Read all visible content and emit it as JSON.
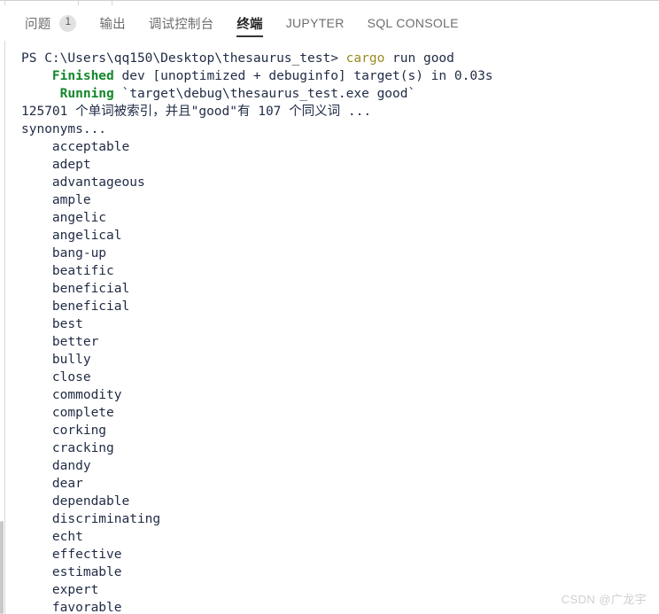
{
  "tabs": [
    {
      "label": "问题",
      "badge": "1",
      "active": false,
      "latin": false
    },
    {
      "label": "输出",
      "badge": null,
      "active": false,
      "latin": false
    },
    {
      "label": "调试控制台",
      "badge": null,
      "active": false,
      "latin": false
    },
    {
      "label": "终端",
      "badge": null,
      "active": true,
      "latin": false
    },
    {
      "label": "JUPYTER",
      "badge": null,
      "active": false,
      "latin": true
    },
    {
      "label": "SQL CONSOLE",
      "badge": null,
      "active": false,
      "latin": true
    }
  ],
  "terminal": {
    "lines": [
      {
        "indent": 0,
        "parts": [
          {
            "text": "PS C:\\Users\\qq150\\Desktop\\thesaurus_test> ",
            "style": "plain"
          },
          {
            "text": "cargo",
            "style": "cmd"
          },
          {
            "text": " run good",
            "style": "plain"
          }
        ]
      },
      {
        "indent": 0,
        "parts": [
          {
            "text": "    ",
            "style": "plain"
          },
          {
            "text": "Finished",
            "style": "ok"
          },
          {
            "text": " dev [unoptimized + debuginfo] target(s) in 0.03s",
            "style": "plain"
          }
        ]
      },
      {
        "indent": 0,
        "parts": [
          {
            "text": "     ",
            "style": "plain"
          },
          {
            "text": "Running",
            "style": "ok"
          },
          {
            "text": " `target\\debug\\thesaurus_test.exe good`",
            "style": "plain"
          }
        ]
      },
      {
        "indent": 0,
        "parts": [
          {
            "text": "125701 个单词被索引，并且\"good\"有 107 个同义词 ...",
            "style": "plain"
          }
        ]
      },
      {
        "indent": 0,
        "parts": [
          {
            "text": "synonyms...",
            "style": "plain"
          }
        ]
      },
      {
        "indent": 0,
        "parts": [
          {
            "text": "    acceptable",
            "style": "plain"
          }
        ]
      },
      {
        "indent": 0,
        "parts": [
          {
            "text": "    adept",
            "style": "plain"
          }
        ]
      },
      {
        "indent": 0,
        "parts": [
          {
            "text": "    advantageous",
            "style": "plain"
          }
        ]
      },
      {
        "indent": 0,
        "parts": [
          {
            "text": "    ample",
            "style": "plain"
          }
        ]
      },
      {
        "indent": 0,
        "parts": [
          {
            "text": "    angelic",
            "style": "plain"
          }
        ]
      },
      {
        "indent": 0,
        "parts": [
          {
            "text": "    angelical",
            "style": "plain"
          }
        ]
      },
      {
        "indent": 0,
        "parts": [
          {
            "text": "    bang-up",
            "style": "plain"
          }
        ]
      },
      {
        "indent": 0,
        "parts": [
          {
            "text": "    beatific",
            "style": "plain"
          }
        ]
      },
      {
        "indent": 0,
        "parts": [
          {
            "text": "    beneficial",
            "style": "plain"
          }
        ]
      },
      {
        "indent": 0,
        "parts": [
          {
            "text": "    beneficial",
            "style": "plain"
          }
        ]
      },
      {
        "indent": 0,
        "parts": [
          {
            "text": "    best",
            "style": "plain"
          }
        ]
      },
      {
        "indent": 0,
        "parts": [
          {
            "text": "    better",
            "style": "plain"
          }
        ]
      },
      {
        "indent": 0,
        "parts": [
          {
            "text": "    bully",
            "style": "plain"
          }
        ]
      },
      {
        "indent": 0,
        "parts": [
          {
            "text": "    close",
            "style": "plain"
          }
        ]
      },
      {
        "indent": 0,
        "parts": [
          {
            "text": "    commodity",
            "style": "plain"
          }
        ]
      },
      {
        "indent": 0,
        "parts": [
          {
            "text": "    complete",
            "style": "plain"
          }
        ]
      },
      {
        "indent": 0,
        "parts": [
          {
            "text": "    corking",
            "style": "plain"
          }
        ]
      },
      {
        "indent": 0,
        "parts": [
          {
            "text": "    cracking",
            "style": "plain"
          }
        ]
      },
      {
        "indent": 0,
        "parts": [
          {
            "text": "    dandy",
            "style": "plain"
          }
        ]
      },
      {
        "indent": 0,
        "parts": [
          {
            "text": "    dear",
            "style": "plain"
          }
        ]
      },
      {
        "indent": 0,
        "parts": [
          {
            "text": "    dependable",
            "style": "plain"
          }
        ]
      },
      {
        "indent": 0,
        "parts": [
          {
            "text": "    discriminating",
            "style": "plain"
          }
        ]
      },
      {
        "indent": 0,
        "parts": [
          {
            "text": "    echt",
            "style": "plain"
          }
        ]
      },
      {
        "indent": 0,
        "parts": [
          {
            "text": "    effective",
            "style": "plain"
          }
        ]
      },
      {
        "indent": 0,
        "parts": [
          {
            "text": "    estimable",
            "style": "plain"
          }
        ]
      },
      {
        "indent": 0,
        "parts": [
          {
            "text": "    expert",
            "style": "plain"
          }
        ]
      },
      {
        "indent": 0,
        "parts": [
          {
            "text": "    favorable",
            "style": "plain"
          }
        ]
      }
    ],
    "command": "cargo run good",
    "cwd": "C:\\Users\\qq150\\Desktop\\thesaurus_test",
    "indexed_words": "125701",
    "query_word": "good",
    "synonym_count": "107"
  },
  "watermark": "CSDN @广龙宇",
  "colors": {
    "command_token": "#9a8a1e",
    "success_token": "#12872b",
    "text": "#1f2a44",
    "tab_active": "#252525",
    "tab_inactive": "#6e6e6e",
    "badge_bg": "#e2e2e2",
    "rule": "#d8d8d8",
    "watermark": "#cfcfcf"
  }
}
